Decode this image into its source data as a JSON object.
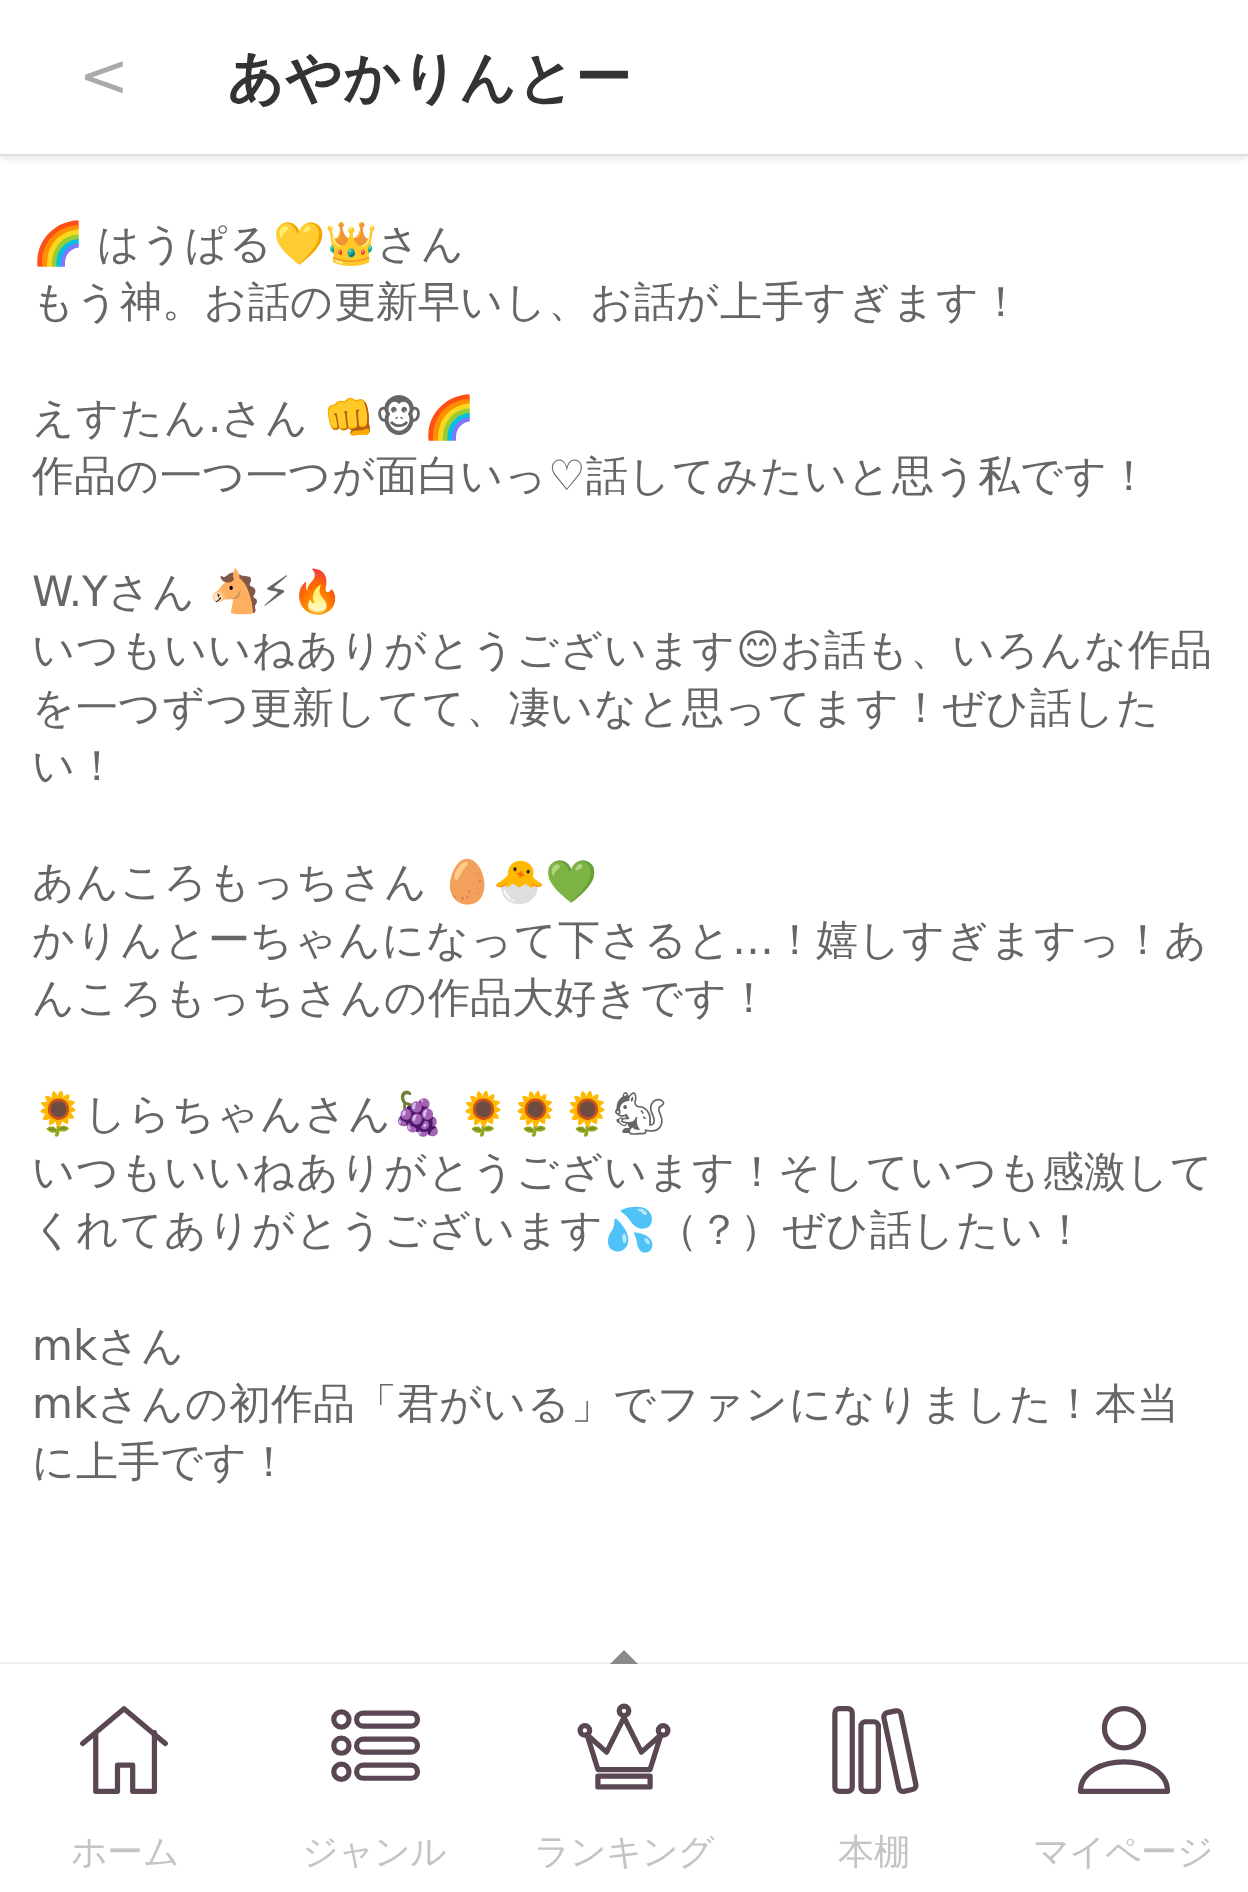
{
  "header": {
    "back": "<",
    "title": "あやかりんとー"
  },
  "entries": [
    {
      "name": "🌈 はうぱる💛👑さん",
      "message": "もう神。お話の更新早いし、お話が上手すぎます！"
    },
    {
      "name": "えすたん.さん 👊🐵🌈",
      "message": "作品の一つ一つが面白いっ♡話してみたいと思う私です！"
    },
    {
      "name": "W.Yさん 🐴⚡🔥",
      "message": "いつもいいねありがとうございます😊お話も、いろんな作品を一つずつ更新してて、凄いなと思ってます！ぜひ話したい！"
    },
    {
      "name": "あんころもっちさん 🥚🐣💚",
      "message": "かりんとーちゃんになって下さると…！嬉しすぎますっ！あんころもっちさんの作品大好きです！"
    },
    {
      "name": "🌻しらちゃんさん🍇 🌻🌻🌻🐿",
      "message": "いつもいいねありがとうございます！そしていつも感激してくれてありがとうございます💦（？）ぜひ話したい！"
    },
    {
      "name": "mkさん",
      "message": "mkさんの初作品「君がいる」でファンになりました！本当に上手です！"
    }
  ],
  "tab_bar": [
    {
      "kind": "home",
      "label": "ホーム"
    },
    {
      "kind": "list",
      "label": "ジャンル"
    },
    {
      "kind": "crown",
      "label": "ランキング"
    },
    {
      "kind": "books",
      "label": "本棚"
    },
    {
      "kind": "person",
      "label": "マイページ"
    }
  ]
}
